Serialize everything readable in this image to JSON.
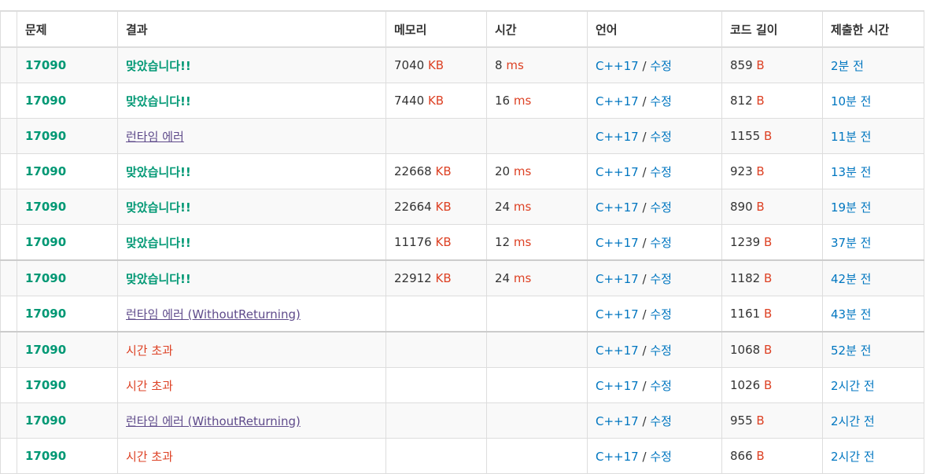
{
  "headers": {
    "problem": "문제",
    "result": "결과",
    "memory": "메모리",
    "time": "시간",
    "language": "언어",
    "code_length": "코드 길이",
    "submitted": "제출한 시간"
  },
  "units": {
    "memory": "KB",
    "time": "ms",
    "length": "B"
  },
  "language_separator": "/",
  "rows": [
    {
      "problem": "17090",
      "result": "맞았습니다!!",
      "kind": "ac",
      "memory": "7040",
      "time": "8",
      "lang": "C++17",
      "edit": "수정",
      "length": "859",
      "submitted": "2분 전"
    },
    {
      "problem": "17090",
      "result": "맞았습니다!!",
      "kind": "ac",
      "memory": "7440",
      "time": "16",
      "lang": "C++17",
      "edit": "수정",
      "length": "812",
      "submitted": "10분 전"
    },
    {
      "problem": "17090",
      "result": "런타임 에러",
      "kind": "rte",
      "memory": "",
      "time": "",
      "lang": "C++17",
      "edit": "수정",
      "length": "1155",
      "submitted": "11분 전"
    },
    {
      "problem": "17090",
      "result": "맞았습니다!!",
      "kind": "ac",
      "memory": "22668",
      "time": "20",
      "lang": "C++17",
      "edit": "수정",
      "length": "923",
      "submitted": "13분 전"
    },
    {
      "problem": "17090",
      "result": "맞았습니다!!",
      "kind": "ac",
      "memory": "22664",
      "time": "24",
      "lang": "C++17",
      "edit": "수정",
      "length": "890",
      "submitted": "19분 전"
    },
    {
      "problem": "17090",
      "result": "맞았습니다!!",
      "kind": "ac",
      "memory": "11176",
      "time": "12",
      "lang": "C++17",
      "edit": "수정",
      "length": "1239",
      "submitted": "37분 전"
    },
    {
      "problem": "17090",
      "result": "맞았습니다!!",
      "kind": "ac",
      "memory": "22912",
      "time": "24",
      "lang": "C++17",
      "edit": "수정",
      "length": "1182",
      "submitted": "42분 전"
    },
    {
      "problem": "17090",
      "result": "런타임 에러 (WithoutReturning)",
      "kind": "rte",
      "memory": "",
      "time": "",
      "lang": "C++17",
      "edit": "수정",
      "length": "1161",
      "submitted": "43분 전"
    },
    {
      "problem": "17090",
      "result": "시간 초과",
      "kind": "tle",
      "memory": "",
      "time": "",
      "lang": "C++17",
      "edit": "수정",
      "length": "1068",
      "submitted": "52분 전"
    },
    {
      "problem": "17090",
      "result": "시간 초과",
      "kind": "tle",
      "memory": "",
      "time": "",
      "lang": "C++17",
      "edit": "수정",
      "length": "1026",
      "submitted": "2시간 전"
    },
    {
      "problem": "17090",
      "result": "런타임 에러 (WithoutReturning)",
      "kind": "rte",
      "memory": "",
      "time": "",
      "lang": "C++17",
      "edit": "수정",
      "length": "955",
      "submitted": "2시간 전"
    },
    {
      "problem": "17090",
      "result": "시간 초과",
      "kind": "tle",
      "memory": "",
      "time": "",
      "lang": "C++17",
      "edit": "수정",
      "length": "866",
      "submitted": "2시간 전"
    }
  ],
  "colors": {
    "accepted": "#009874",
    "runtime_error": "#5f4b8b",
    "time_limit": "#dd4124",
    "link": "#0076c0",
    "unit": "#dd4124"
  }
}
